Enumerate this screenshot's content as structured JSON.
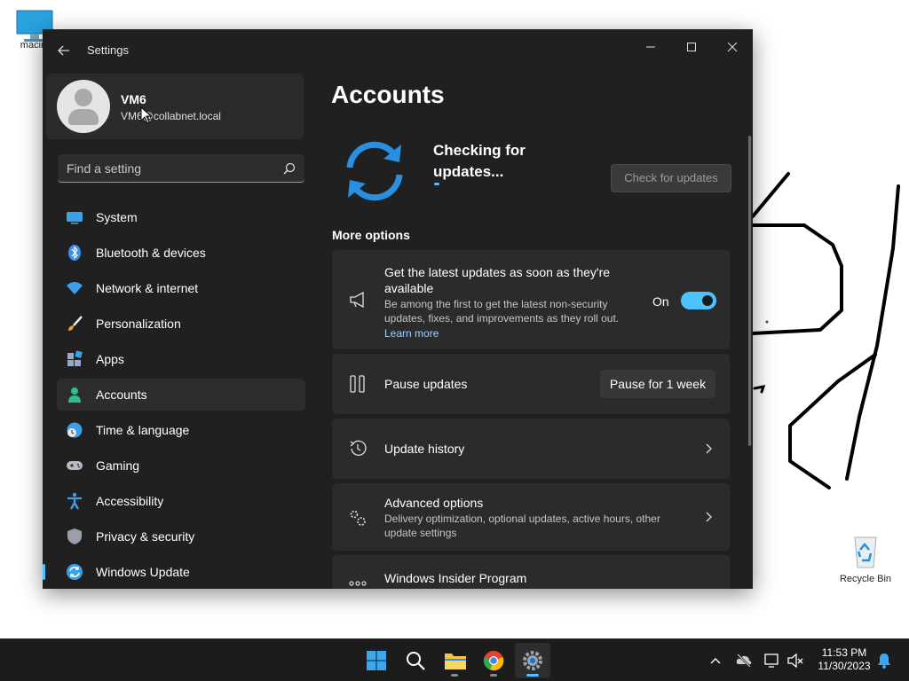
{
  "desktop": {
    "icons": [
      {
        "label": "macint"
      },
      {
        "label": "Recycle Bin"
      }
    ]
  },
  "window": {
    "title": "Settings"
  },
  "profile": {
    "name": "VM6",
    "email": "VM6@collabnet.local"
  },
  "search": {
    "placeholder": "Find a setting"
  },
  "sidebar": {
    "items": [
      {
        "label": "System"
      },
      {
        "label": "Bluetooth & devices"
      },
      {
        "label": "Network & internet"
      },
      {
        "label": "Personalization"
      },
      {
        "label": "Apps"
      },
      {
        "label": "Accounts"
      },
      {
        "label": "Time & language"
      },
      {
        "label": "Gaming"
      },
      {
        "label": "Accessibility"
      },
      {
        "label": "Privacy & security"
      },
      {
        "label": "Windows Update"
      }
    ],
    "active_item": "Accounts",
    "selected_item": "Windows Update"
  },
  "main": {
    "title": "Accounts",
    "status": "Checking for updates...",
    "check_button": "Check for updates",
    "more_options": "More options",
    "cards": {
      "latest": {
        "title": "Get the latest updates as soon as they're available",
        "subtitle": "Be among the first to get the latest non-security updates, fixes, and improvements as they roll out.",
        "link": "Learn more",
        "toggle_label": "On"
      },
      "pause": {
        "title": "Pause updates",
        "button": "Pause for 1 week"
      },
      "history": {
        "title": "Update history"
      },
      "advanced": {
        "title": "Advanced options",
        "subtitle": "Delivery optimization, optional updates, active hours, other update settings"
      },
      "insider": {
        "title": "Windows Insider Program"
      }
    }
  },
  "taskbar": {
    "time": "11:53 PM",
    "date": "11/30/2023"
  },
  "colors": {
    "accent": "#4cc2ff",
    "window_bg": "#202020",
    "card_bg": "#2b2b2b"
  }
}
